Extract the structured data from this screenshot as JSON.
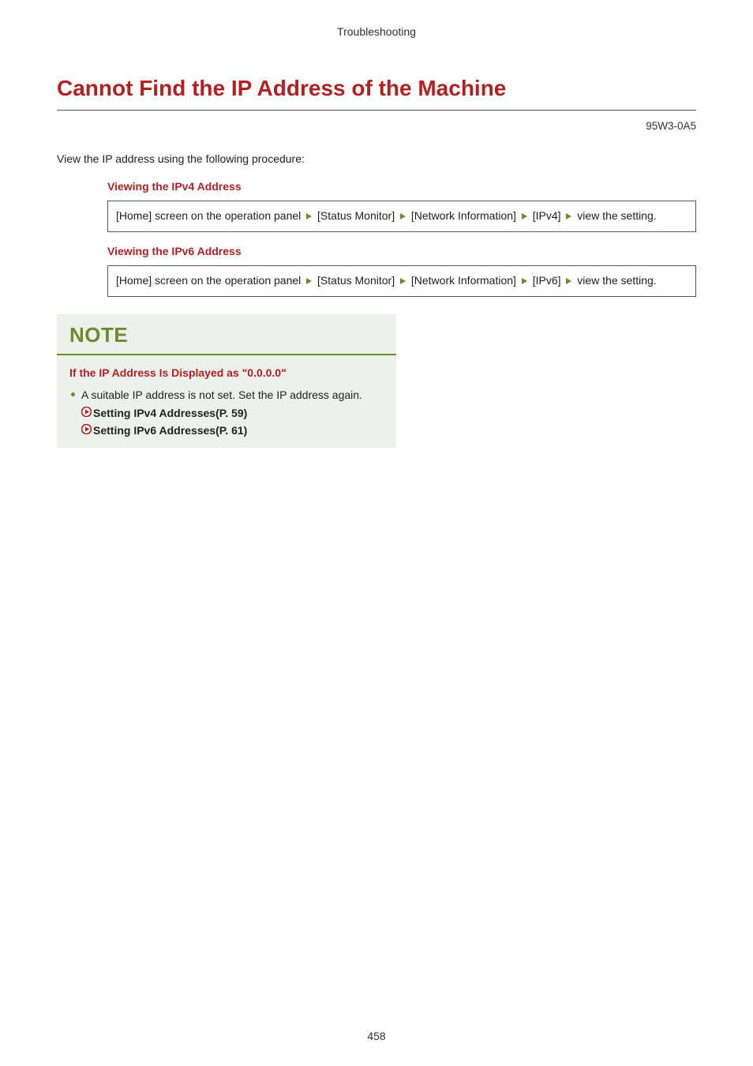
{
  "header": {
    "section": "Troubleshooting"
  },
  "title": "Cannot Find the IP Address of the Machine",
  "doc_code": "95W3-0A5",
  "intro": "View the IP address using the following procedure:",
  "ipv4": {
    "heading": "Viewing the IPv4 Address",
    "steps": {
      "s1": "[Home] screen on the operation panel",
      "s2": "[Status Monitor]",
      "s3": "[Network Information]",
      "s4": "[IPv4]",
      "tail": "view the setting."
    }
  },
  "ipv6": {
    "heading": "Viewing the IPv6 Address",
    "steps": {
      "s1": "[Home] screen on the operation panel",
      "s2": "[Status Monitor]",
      "s3": "[Network Information]",
      "s4": "[IPv6]",
      "tail": "view the setting."
    }
  },
  "note": {
    "title": "NOTE",
    "sub": "If the IP Address Is Displayed as \"0.0.0.0\"",
    "bullet_text": "A suitable IP address is not set. Set the IP address again.",
    "xref1": "Setting IPv4 Addresses(P. 59)",
    "xref2": "Setting IPv6 Addresses(P. 61)"
  },
  "page_number": "458"
}
